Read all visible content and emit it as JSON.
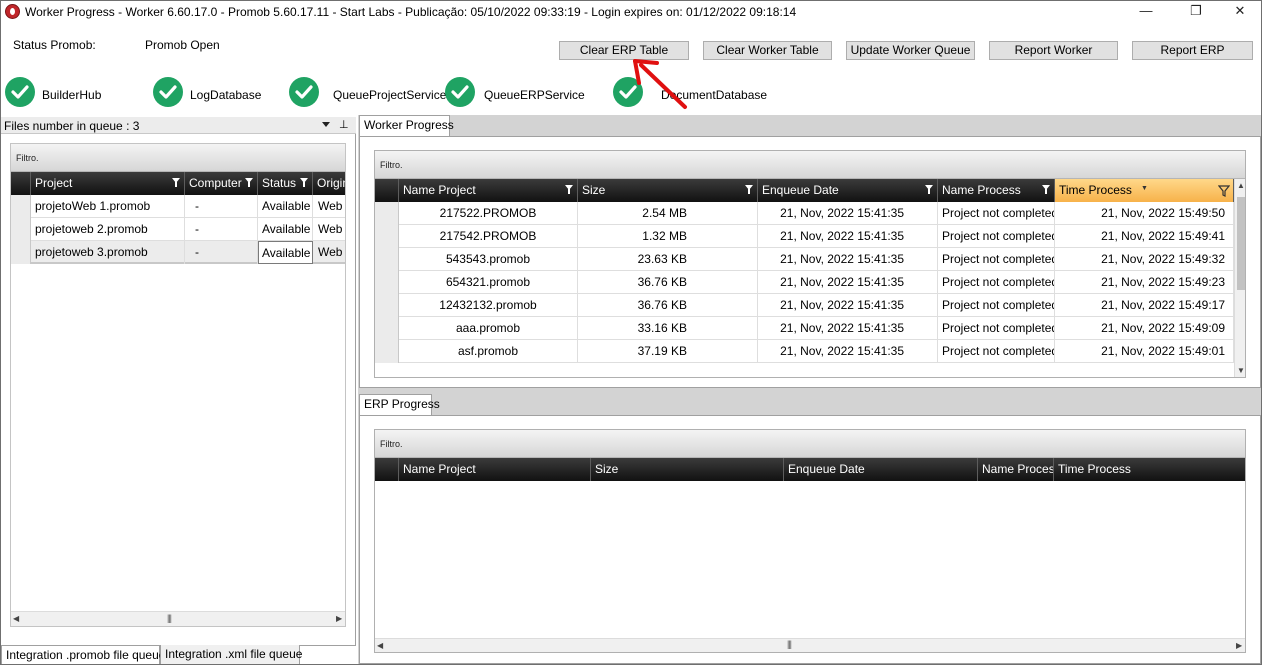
{
  "window": {
    "title": "Worker Progress  -  Worker 6.60.17.0 - Promob 5.60.17.11  -  Start Labs  -  Publicação: 05/10/2022 09:33:19 - Login expires on: 01/12/2022 09:18:14",
    "minimize": "—",
    "maximize": "❐",
    "close": "✕"
  },
  "status": {
    "label": "Status Promob:",
    "value": "Promob Open"
  },
  "toolbar": {
    "clear_erp": "Clear ERP Table",
    "clear_worker": "Clear Worker Table",
    "update_queue": "Update Worker Queue",
    "report_worker": "Report Worker",
    "report_erp": "Report ERP"
  },
  "services": [
    {
      "label": "BuilderHub",
      "status": "ok"
    },
    {
      "label": "LogDatabase",
      "status": "ok"
    },
    {
      "label": "QueueProjectService",
      "status": "ok"
    },
    {
      "label": "QueueERPService",
      "status": "ok"
    },
    {
      "label": "DocumentDatabase",
      "status": "ok"
    }
  ],
  "queue_panel": {
    "header": "Files number in queue : 3",
    "filter": "Filtro.",
    "columns": [
      "Project",
      "Computer",
      "Status",
      "Origin"
    ],
    "rows": [
      [
        "projetoWeb 1.promob",
        "-",
        "Available",
        "Web"
      ],
      [
        "projetoweb 2.promob",
        "-",
        "Available",
        "Web"
      ],
      [
        "projetoweb 3.promob",
        "-",
        "Available",
        "Web"
      ]
    ],
    "tabs": [
      "Integration .promob file queue",
      "Integration .xml file queue"
    ]
  },
  "worker_progress": {
    "tab": "Worker Progress",
    "filter": "Filtro.",
    "columns": [
      "Name Project",
      "Size",
      "Enqueue Date",
      "Name Process",
      "Time Process"
    ],
    "rows": [
      [
        "217522.PROMOB",
        "2.54 MB",
        "21, Nov, 2022 15:41:35",
        "Project not completed",
        "21, Nov, 2022 15:49:50"
      ],
      [
        "217542.PROMOB",
        "1.32 MB",
        "21, Nov, 2022 15:41:35",
        "Project not completed",
        "21, Nov, 2022 15:49:41"
      ],
      [
        "543543.promob",
        "23.63 KB",
        "21, Nov, 2022 15:41:35",
        "Project not completed",
        "21, Nov, 2022 15:49:32"
      ],
      [
        "654321.promob",
        "36.76 KB",
        "21, Nov, 2022 15:41:35",
        "Project not completed",
        "21, Nov, 2022 15:49:23"
      ],
      [
        "12432132.promob",
        "36.76 KB",
        "21, Nov, 2022 15:41:35",
        "Project not completed",
        "21, Nov, 2022 15:49:17"
      ],
      [
        "aaa.promob",
        "33.16 KB",
        "21, Nov, 2022 15:41:35",
        "Project not completed",
        "21, Nov, 2022 15:49:09"
      ],
      [
        "asf.promob",
        "37.19 KB",
        "21, Nov, 2022 15:41:35",
        "Project not completed",
        "21, Nov, 2022 15:49:01"
      ]
    ]
  },
  "erp_progress": {
    "tab": "ERP Progress",
    "filter": "Filtro.",
    "columns": [
      "Name Project",
      "Size",
      "Enqueue Date",
      "Name Process",
      "Time Process"
    ]
  },
  "colors": {
    "check": "#1fa363",
    "header_dark": "#111111",
    "active_header": "#f7b24a",
    "annotation_arrow": "#e01010"
  }
}
